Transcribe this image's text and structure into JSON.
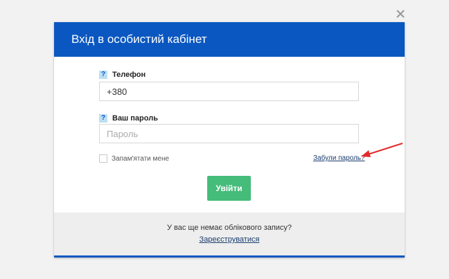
{
  "modal": {
    "title": "Вхід в особистий кабінет",
    "accent_color": "#0a57c1"
  },
  "phone": {
    "help": "?",
    "label": "Телефон",
    "value": "+380"
  },
  "password": {
    "help": "?",
    "label": "Ваш пароль",
    "placeholder": "Пароль"
  },
  "remember": {
    "label": "Запам'ятати мене",
    "checked": false
  },
  "forgot_link": "Забули пароль?",
  "login_button": {
    "label": "Увійти",
    "color": "#45bc7a"
  },
  "footer": {
    "text": "У вас ще немає облікового запису?",
    "register_link": "Зареєструватися"
  },
  "icons": {
    "close": "close-icon",
    "annotation_arrow": "red-arrow-icon"
  }
}
